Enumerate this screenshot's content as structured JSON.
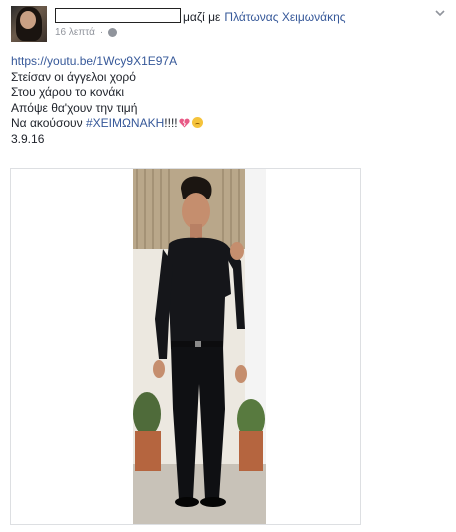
{
  "post": {
    "author_redacted": "",
    "with_text": "μαζί με",
    "tagged_name": "Πλάτωνας Χειμωνάκης",
    "timestamp": "16 λεπτά",
    "privacy_icon": "globe-icon",
    "options_icon": "chevron-down-icon",
    "body": {
      "link": "https://youtu.be/1Wcy9X1E97A",
      "lines": [
        "Στείσαν οι άγγελοι χορό",
        "Στου χάρου το κονάκι",
        "Απόψε θα'χουν την τιμή"
      ],
      "last_line_prefix": "Να ακούσουν ",
      "hashtag": "#ΧΕΙΜΩΝΑΚΗ",
      "exclamations": "!!!!",
      "emoji": [
        "broken-heart-icon",
        "crying-face-icon"
      ],
      "date": "3.9.16"
    },
    "photo_alt": "photo"
  },
  "colors": {
    "link": "#365899",
    "text": "#1d2129",
    "meta": "#90949c",
    "border": "#dddfe2"
  }
}
